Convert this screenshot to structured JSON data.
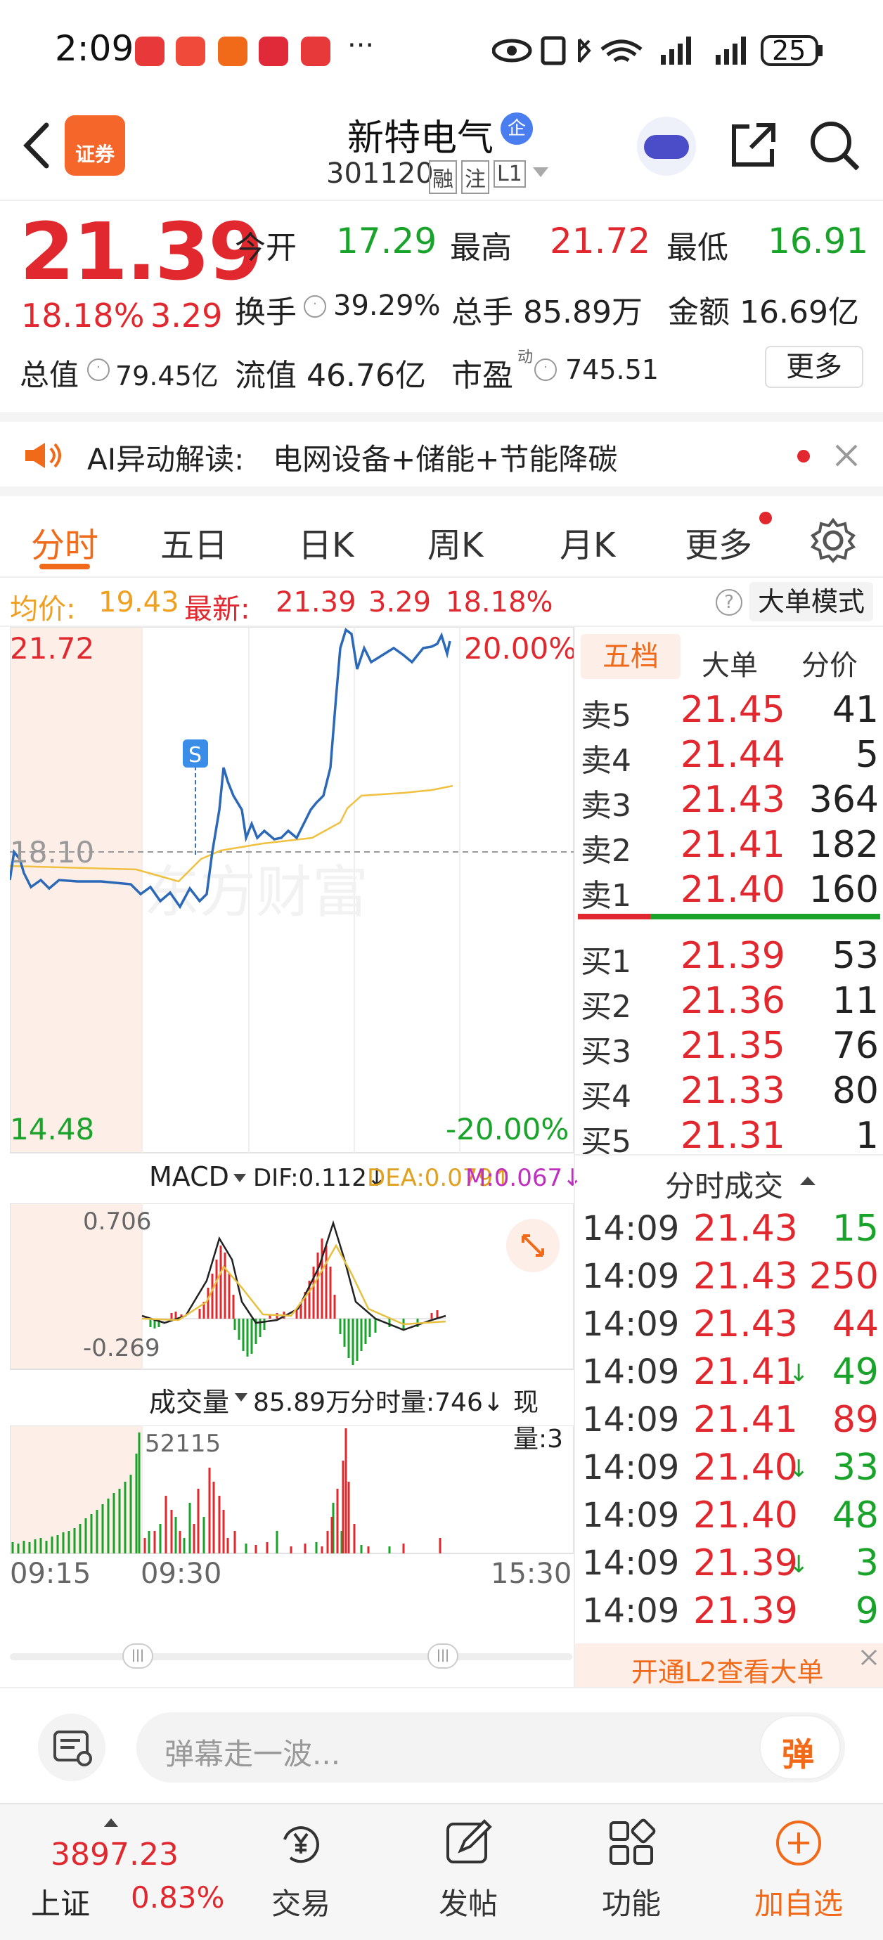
{
  "status": {
    "time": "2:09",
    "more": "···",
    "battery": "25"
  },
  "header": {
    "logo": "证券",
    "title": "新特电气",
    "badge": "企",
    "code": "301120",
    "tag1": "融",
    "tag2": "注",
    "tag3": "L1"
  },
  "quote": {
    "price": "21.39",
    "pct": "18.18%",
    "chg": "3.29",
    "open_label": "今开",
    "open": "17.29",
    "high_label": "最高",
    "high": "21.72",
    "low_label": "最低",
    "low": "16.91",
    "turn_label": "换手",
    "turn": "39.29%",
    "vol_label": "总手",
    "vol": "85.89万",
    "amt_label": "金额",
    "amt": "16.69亿",
    "cap_label": "总值",
    "cap": "79.45亿",
    "float_label": "流值",
    "float": "46.76亿",
    "pe_label": "市盈",
    "pe_sup": "动",
    "pe": "745.51",
    "more": "更多"
  },
  "ai": {
    "label": "AI异动解读:",
    "text": "电网设备+储能+节能降碳"
  },
  "tabs": [
    "分时",
    "五日",
    "日K",
    "周K",
    "月K",
    "更多"
  ],
  "infobar": {
    "avg_label": "均价:",
    "avg": "19.43",
    "last_label": "最新:",
    "last": "21.39",
    "chg": "3.29",
    "pct": "18.18%",
    "mode": "大单模式",
    "help": "?"
  },
  "chart": {
    "top": "21.72",
    "bottom": "14.48",
    "mid": "18.10",
    "top_pct": "20.00%",
    "bottom_pct": "-20.00%",
    "marker": "S",
    "watermark": "东方财富",
    "macd_label": "MACD",
    "dif": "DIF:0.112↓",
    "dea": "DEA:0.079↑",
    "m": "M:0.067↓",
    "macd_hi": "0.706",
    "macd_lo": "-0.269",
    "vol_label": "成交量",
    "vol_total": "85.89万",
    "vol_min": "分时量:746↓",
    "vol_now": "现量:3",
    "vol_max": "52115",
    "t_start": "09:15",
    "t_mid": "09:30",
    "t_end": "15:30"
  },
  "chart_data": {
    "type": "line",
    "x": [
      "09:15",
      "09:30",
      "15:30"
    ],
    "series": [],
    "ylim": [
      14.48,
      21.72
    ]
  },
  "order": {
    "tabs": [
      "五档",
      "大单",
      "分价"
    ],
    "asks": [
      {
        "l": "卖5",
        "p": "21.45",
        "v": "41"
      },
      {
        "l": "卖4",
        "p": "21.44",
        "v": "5"
      },
      {
        "l": "卖3",
        "p": "21.43",
        "v": "364"
      },
      {
        "l": "卖2",
        "p": "21.41",
        "v": "182"
      },
      {
        "l": "卖1",
        "p": "21.40",
        "v": "160"
      }
    ],
    "bids": [
      {
        "l": "买1",
        "p": "21.39",
        "v": "53"
      },
      {
        "l": "买2",
        "p": "21.36",
        "v": "11"
      },
      {
        "l": "买3",
        "p": "21.35",
        "v": "76"
      },
      {
        "l": "买4",
        "p": "21.33",
        "v": "80"
      },
      {
        "l": "买5",
        "p": "21.31",
        "v": "1"
      }
    ],
    "ticks_title": "分时成交",
    "ticks": [
      {
        "t": "14:09",
        "p": "21.43",
        "a": "",
        "v": "15"
      },
      {
        "t": "14:09",
        "p": "21.43",
        "a": "",
        "v": "250"
      },
      {
        "t": "14:09",
        "p": "21.43",
        "a": "",
        "v": "44"
      },
      {
        "t": "14:09",
        "p": "21.41",
        "a": "↓",
        "v": "49"
      },
      {
        "t": "14:09",
        "p": "21.41",
        "a": "",
        "v": "89"
      },
      {
        "t": "14:09",
        "p": "21.40",
        "a": "↓",
        "v": "33"
      },
      {
        "t": "14:09",
        "p": "21.40",
        "a": "",
        "v": "48"
      },
      {
        "t": "14:09",
        "p": "21.39",
        "a": "↓",
        "v": "3"
      },
      {
        "t": "14:09",
        "p": "21.39",
        "a": "",
        "v": "9"
      }
    ],
    "l2": "开通L2查看大单"
  },
  "comment": {
    "placeholder": "弹幕走一波...",
    "btn": "弹"
  },
  "bottom": {
    "index": "3897.23",
    "market": "上证",
    "index_pct": "0.83%",
    "trade": "交易",
    "post": "发帖",
    "func": "功能",
    "add": "加自选"
  }
}
